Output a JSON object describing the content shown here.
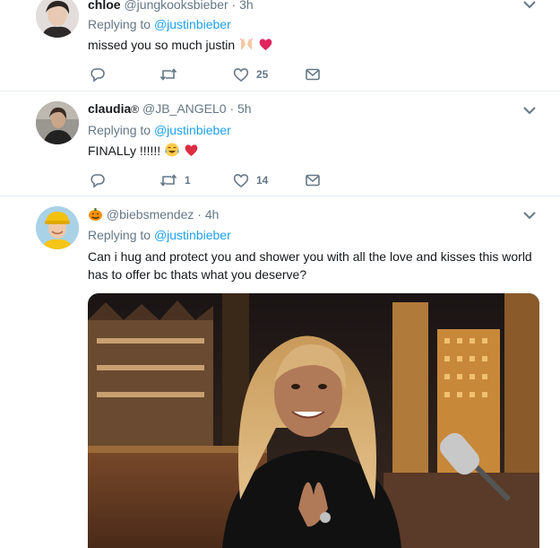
{
  "tweets": [
    {
      "name": "chloe",
      "handle": "@jungkooksbieber",
      "time": "· 3h",
      "replying_label": "Replying to",
      "replying_to": "@justinbieber",
      "text": "missed you so much justin",
      "emoji": [
        "raised-hands",
        "heart"
      ],
      "retweets": "",
      "likes": "25"
    },
    {
      "name": "claudia",
      "badge": "®",
      "handle": "@JB_ANGEL0",
      "time": "· 5h",
      "replying_label": "Replying to",
      "replying_to": "@justinbieber",
      "text": "FINALLy !!!!!!",
      "emoji": [
        "tears-of-joy",
        "heart"
      ],
      "retweets": "1",
      "likes": "14"
    },
    {
      "name_prefix_emoji": "pumpkin",
      "handle": "@biebsmendez",
      "time": "· 4h",
      "replying_label": "Replying to",
      "replying_to": "@justinbieber",
      "text": "Can i hug and protect you and shower you with all the love and kisses this world has to offer bc thats what you deserve?"
    }
  ],
  "colors": {
    "accent": "#1da1f2",
    "secondary": "#657786",
    "heart": "#e0245e",
    "divider": "#e6ecf0"
  },
  "icons": [
    "reply-icon",
    "retweet-icon",
    "like-icon",
    "dm-icon",
    "chevron-down-icon"
  ]
}
